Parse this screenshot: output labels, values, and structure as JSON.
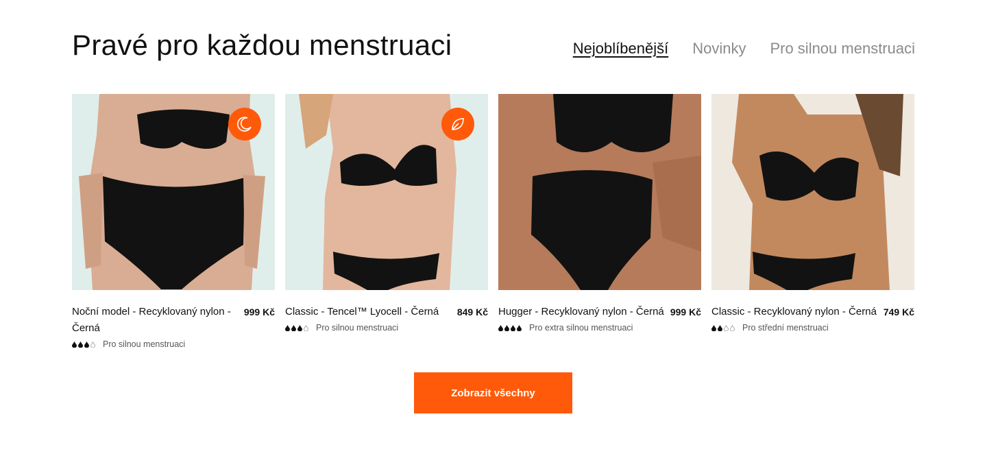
{
  "section": {
    "title": "Pravé pro každou menstruaci",
    "tabs": [
      {
        "label": "Nejoblíbenější",
        "active": true
      },
      {
        "label": "Novinky",
        "active": false
      },
      {
        "label": "Pro silnou menstruaci",
        "active": false
      }
    ]
  },
  "products": [
    {
      "name": "Noční model - Recyklovaný nylon - Černá",
      "price": "999 Kč",
      "absorbency_level": 3,
      "absorbency_max": 4,
      "absorbency_label": "Pro silnou menstruaci",
      "badge_icon": "moon-icon",
      "background": "#dfeeeb"
    },
    {
      "name": "Classic - Tencel™ Lyocell - Černá",
      "price": "849 Kč",
      "absorbency_level": 3,
      "absorbency_max": 4,
      "absorbency_label": "Pro silnou menstruaci",
      "badge_icon": "leaf-icon",
      "background": "#e0eeeb"
    },
    {
      "name": "Hugger - Recyklovaný nylon - Černá",
      "price": "999 Kč",
      "absorbency_level": 4,
      "absorbency_max": 4,
      "absorbency_label": "Pro extra silnou menstruaci",
      "badge_icon": null,
      "background": "#f1ede8"
    },
    {
      "name": "Classic - Recyklovaný nylon - Černá",
      "price": "749 Kč",
      "absorbency_level": 2,
      "absorbency_max": 4,
      "absorbency_label": "Pro střední menstruaci",
      "badge_icon": null,
      "background": "#eee8df"
    }
  ],
  "cta": {
    "label": "Zobrazit všechny"
  },
  "colors": {
    "accent": "#ff5a0a",
    "text": "#111111",
    "muted": "#8a8a8a"
  }
}
